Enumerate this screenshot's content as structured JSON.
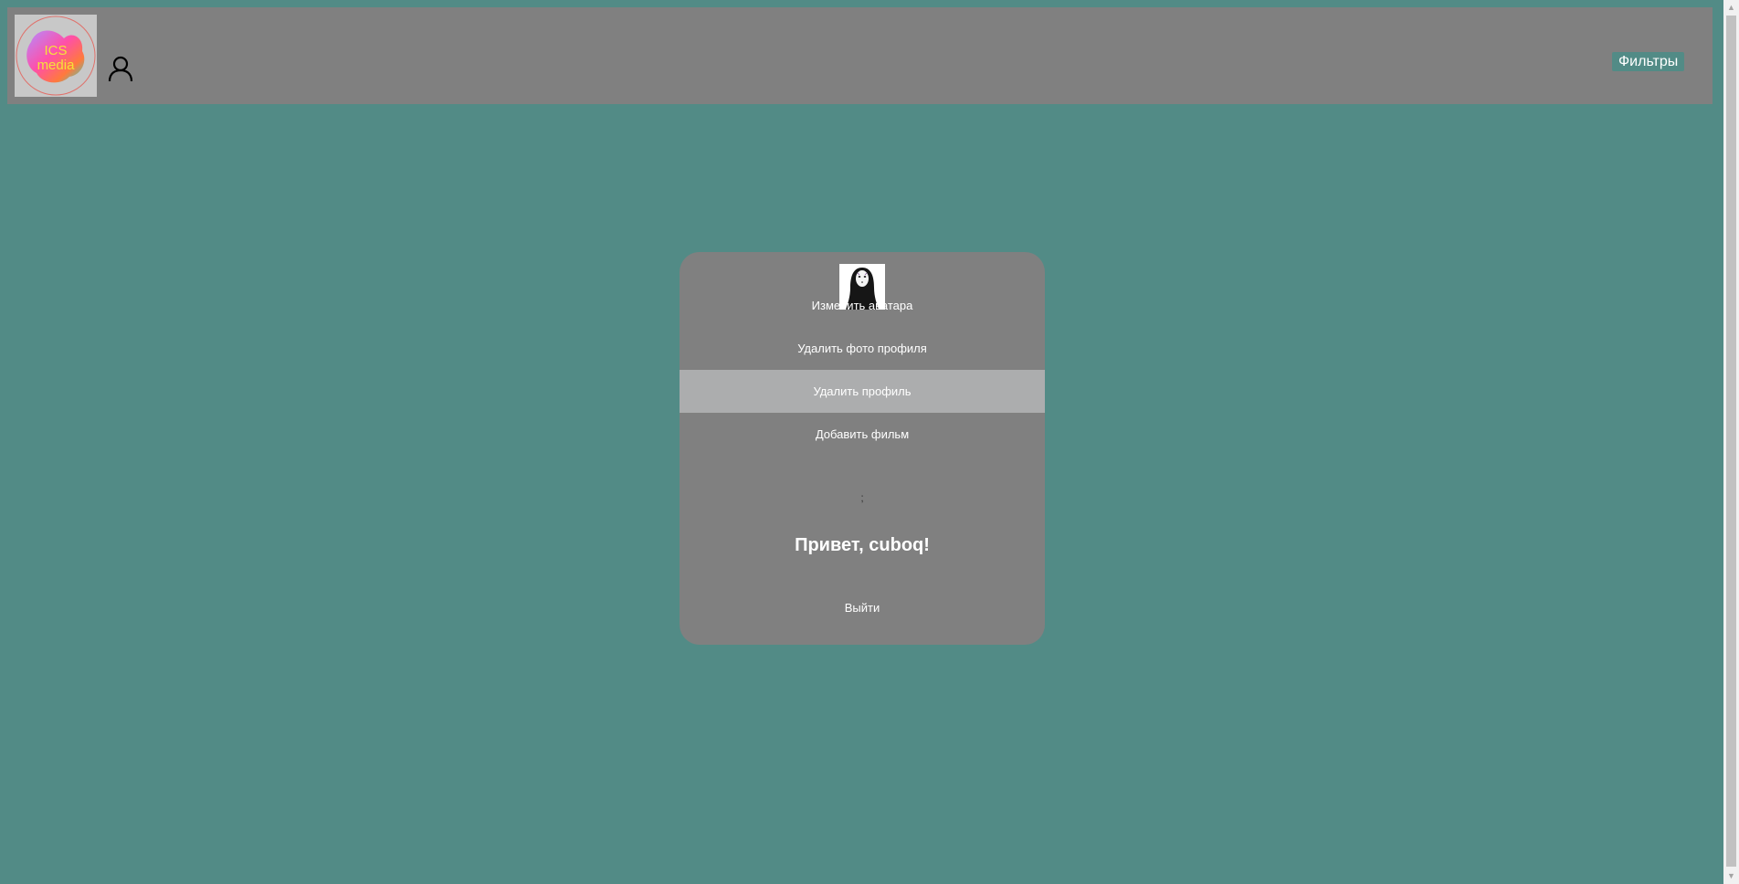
{
  "header": {
    "logo": {
      "line1": "ICS",
      "line2": "media"
    },
    "user_icon": "user-icon",
    "filters_label": "Фильтры"
  },
  "profile_card": {
    "avatar_icon": "no-face-avatar",
    "menu": [
      {
        "label": "Изменить аватара"
      },
      {
        "label": "Удалить фото профиля"
      },
      {
        "label": "Удалить профиль"
      },
      {
        "label": "Добавить фильм"
      }
    ],
    "separator": ";",
    "greeting": "Привет, cuboq!",
    "logout_label": "Выйти"
  },
  "colors": {
    "page_background": "#528b86",
    "header_background": "#808080",
    "card_background": "#808080",
    "menu_highlight": "#acadae",
    "filters_button": "#528b86"
  }
}
